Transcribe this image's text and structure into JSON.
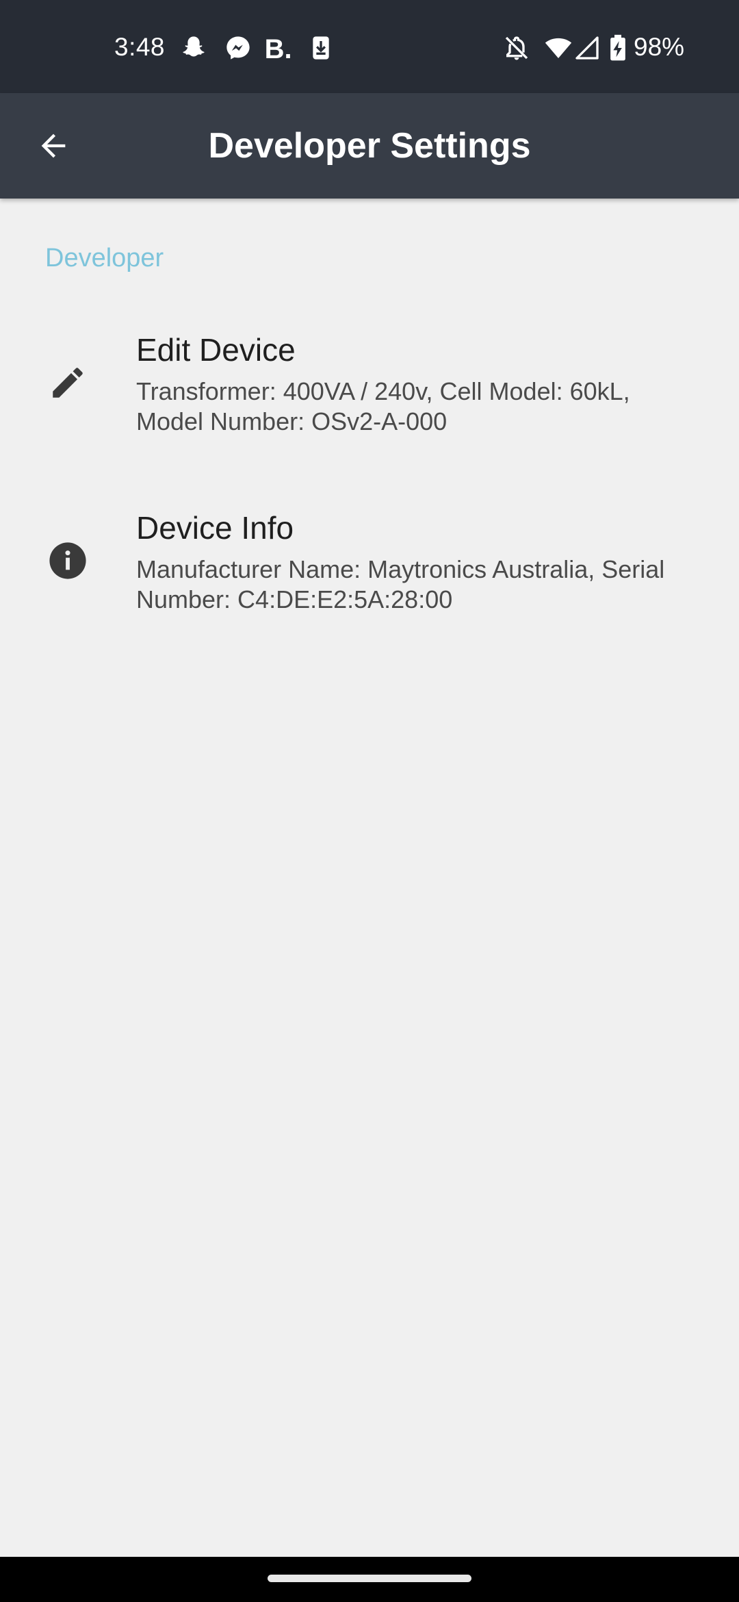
{
  "status_bar": {
    "time": "3:48",
    "battery_percent": "98%",
    "icons_left": [
      "snapchat-icon",
      "messenger-icon",
      "b-dot-icon",
      "download-icon"
    ],
    "icons_right": [
      "bell-off-icon",
      "wifi-icon",
      "cell-signal-icon",
      "battery-charging-icon"
    ]
  },
  "app_bar": {
    "title": "Developer Settings",
    "back_icon": "arrow-left-icon",
    "background": "#373d47"
  },
  "section": {
    "title": "Developer",
    "accent_color": "#7ec4db"
  },
  "items": [
    {
      "icon": "pencil-icon",
      "title": "Edit Device",
      "summary": "Transformer: 400VA / 240v, Cell Model: 60kL, Model Number: OSv2-A-000"
    },
    {
      "icon": "info-icon",
      "title": "Device Info",
      "summary": "Manufacturer Name: Maytronics Australia, Serial Number: C4:DE:E2:5A:28:00"
    }
  ]
}
